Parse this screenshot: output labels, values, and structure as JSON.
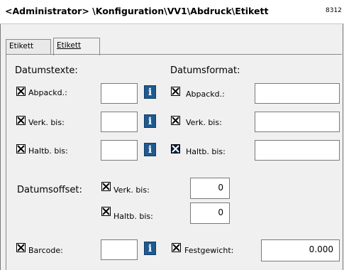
{
  "window": {
    "title": "<Administrator> \\Konfiguration\\VV1\\Abdruck\\Etikett",
    "code": "8312"
  },
  "tabs": [
    {
      "label": "Etikett"
    },
    {
      "label": "Etikett"
    }
  ],
  "sections": {
    "datumstexte": "Datumstexte:",
    "datumsformat": "Datumsformat:",
    "datumsoffset": "Datumsoffset:"
  },
  "datumstexte": [
    {
      "label": "Abpackd.:",
      "checked": true,
      "value": ""
    },
    {
      "label": "Verk. bis:",
      "checked": true,
      "value": ""
    },
    {
      "label": "Haltb. bis:",
      "checked": true,
      "value": ""
    }
  ],
  "datumsformat": [
    {
      "label": "Abpackd.:",
      "checked": true,
      "value": ""
    },
    {
      "label": "Verk. bis:",
      "checked": true,
      "value": ""
    },
    {
      "label": "Haltb. bis:",
      "checked": true,
      "value": ""
    }
  ],
  "offset": [
    {
      "label": "Verk. bis:",
      "checked": true,
      "value": "0"
    },
    {
      "label": "Haltb. bis:",
      "checked": true,
      "value": "0"
    }
  ],
  "barcode": {
    "label": "Barcode:",
    "checked": true,
    "value": ""
  },
  "festgewicht": {
    "label": "Festgewicht:",
    "checked": true,
    "value": "0.000"
  },
  "info_icon": {
    "glyph": "i",
    "color": "#1e5a8f"
  }
}
